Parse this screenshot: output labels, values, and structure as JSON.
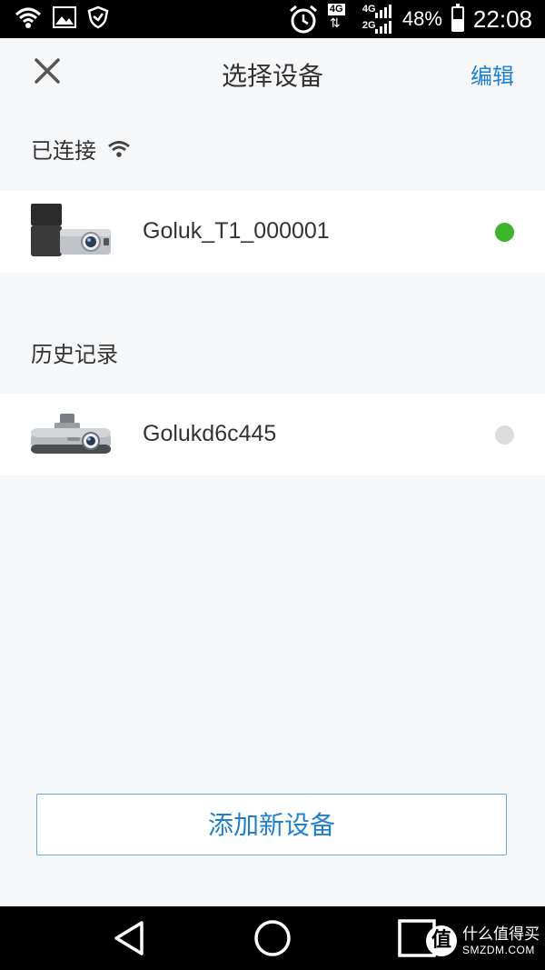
{
  "status_bar": {
    "network_type": "4G",
    "network_type_2": "4G",
    "network_type_3": "2G",
    "battery_percent_text": "48%",
    "battery_level": 0.48,
    "time": "22:08"
  },
  "header": {
    "close_icon": "close-icon",
    "title": "选择设备",
    "edit_label": "编辑"
  },
  "connected": {
    "label": "已连接",
    "icon": "wifi-icon",
    "devices": [
      {
        "name": "Goluk_T1_000001",
        "status_color": "#3cb52a"
      }
    ]
  },
  "history": {
    "label": "历史记录",
    "devices": [
      {
        "name": "Golukd6c445",
        "status_color": "#dcdcdc"
      }
    ]
  },
  "add_button": {
    "label": "添加新设备"
  },
  "watermark": {
    "badge": "值",
    "line1": "什么值得买",
    "line2": "SMZDM.COM"
  }
}
